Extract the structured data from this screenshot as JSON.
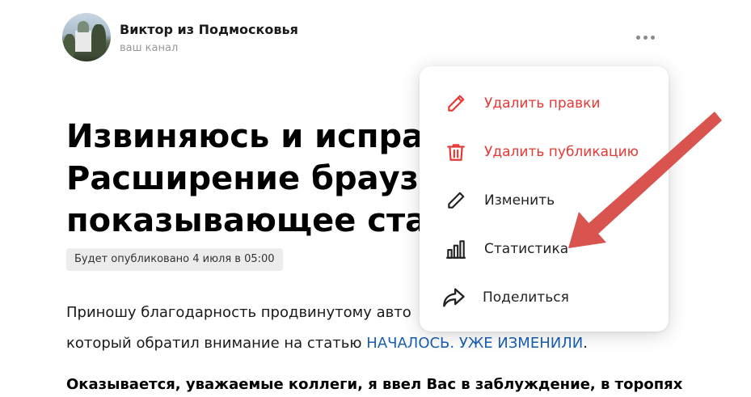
{
  "channel": {
    "name": "Виктор из Подмосковья",
    "subtitle": "ваш канал"
  },
  "article": {
    "title": "Извиняюсь и исправ.\nРасширение браузера\nпоказывающее стати",
    "badge": "Будет опубликовано 4 июля в 05:00",
    "para1_line1": "Приношу благодарность продвинутому авто",
    "para1_line2_text": "который обратил внимание на статью ",
    "para1_link": "НАЧАЛОСЬ. УЖЕ ИЗМЕНИЛИ",
    "para1_line2_end": ".",
    "para2": "Оказывается, уважаемые коллеги, я ввел Вас в заблуждение, в торопях"
  },
  "menu": {
    "items": [
      {
        "label": "Удалить правки",
        "icon": "pencil-icon",
        "color": "#e53935"
      },
      {
        "label": "Удалить публикацию",
        "icon": "trash-icon",
        "color": "#e53935"
      },
      {
        "label": "Изменить",
        "icon": "pencil-icon",
        "color": "#222222"
      },
      {
        "label": "Статистика",
        "icon": "bar-chart-icon",
        "color": "#222222"
      },
      {
        "label": "Поделиться",
        "icon": "share-icon",
        "color": "#222222"
      }
    ]
  },
  "colors": {
    "danger": "#e53935",
    "link": "#1a5fb4",
    "annotation_arrow": "#d9534f"
  }
}
